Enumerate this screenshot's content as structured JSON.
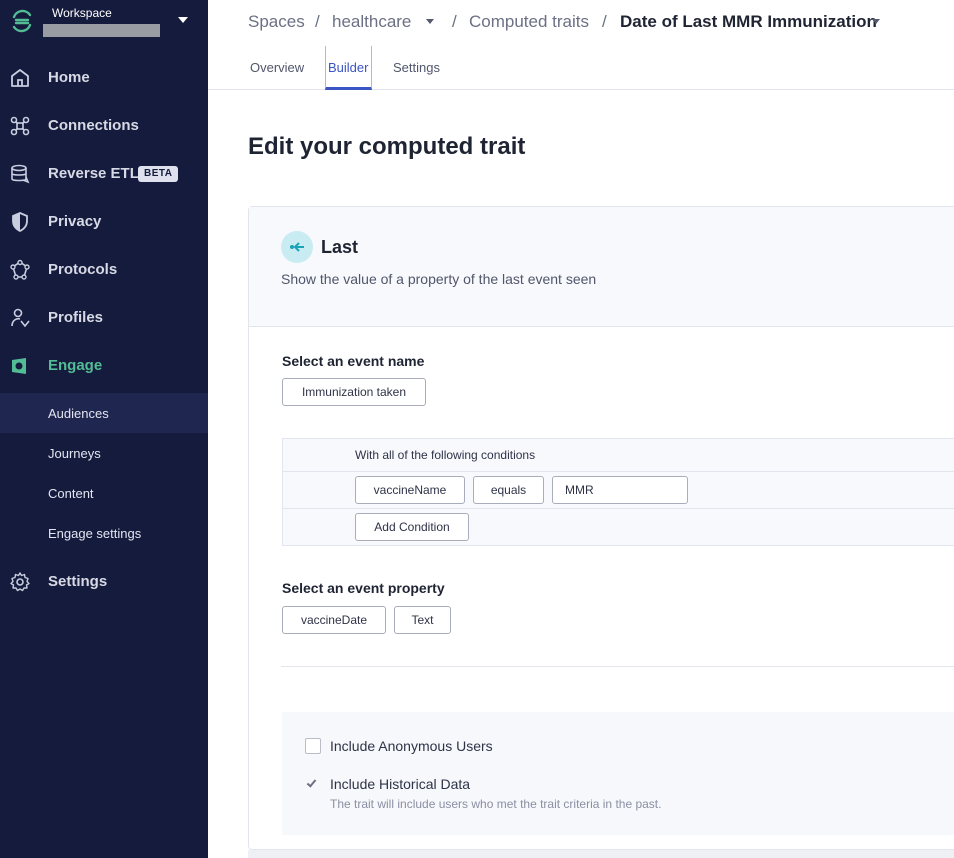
{
  "workspace": {
    "label": "Workspace"
  },
  "sidebar": {
    "nav": [
      {
        "label": "Home",
        "icon": "home-icon"
      },
      {
        "label": "Connections",
        "icon": "connections-icon"
      },
      {
        "label": "Reverse ETL",
        "icon": "database-icon",
        "badge": "BETA"
      },
      {
        "label": "Privacy",
        "icon": "shield-icon"
      },
      {
        "label": "Protocols",
        "icon": "protocols-icon"
      },
      {
        "label": "Profiles",
        "icon": "profile-icon"
      },
      {
        "label": "Engage",
        "icon": "engage-icon",
        "active": true
      }
    ],
    "sub_items": [
      {
        "label": "Audiences",
        "selected": true
      },
      {
        "label": "Journeys"
      },
      {
        "label": "Content"
      },
      {
        "label": "Engage settings"
      }
    ],
    "settings": {
      "label": "Settings",
      "icon": "gear-icon"
    },
    "accent": "#52bd94",
    "background": "#151b3d"
  },
  "header": {
    "breadcrumbs": [
      {
        "label": "Spaces"
      },
      {
        "label": "healthcare",
        "dropdown": true
      },
      {
        "label": "Computed traits"
      },
      {
        "label": "Date of Last MMR Immunization",
        "dropdown": true,
        "current": true
      }
    ],
    "separator": "/",
    "tabs": [
      {
        "label": "Overview"
      },
      {
        "label": "Builder",
        "active": true
      },
      {
        "label": "Settings"
      }
    ]
  },
  "main": {
    "title": "Edit your computed trait",
    "trait_type": {
      "title": "Last",
      "description": "Show the value of a property of the last event seen",
      "icon": "arrow-left-icon"
    },
    "event_name": {
      "label": "Select an event name",
      "value": "Immunization taken"
    },
    "conditions": {
      "title": "With all of the following conditions",
      "rows": [
        {
          "property": "vaccineName",
          "operator": "equals",
          "value": "MMR"
        }
      ],
      "add_label": "Add Condition"
    },
    "event_property": {
      "label": "Select an event property",
      "value": "vaccineDate",
      "type": "Text"
    },
    "options": {
      "anonymous": {
        "label": "Include Anonymous Users",
        "checked": false
      },
      "historical": {
        "label": "Include Historical Data",
        "help": "The trait will include users who met the trait criteria in the past.",
        "checked": true
      }
    }
  }
}
